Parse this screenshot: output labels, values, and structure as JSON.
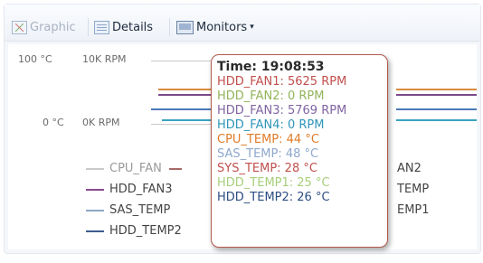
{
  "toolbar": {
    "graphic_label": "Graphic",
    "details_label": "Details",
    "monitors_label": "Monitors",
    "monitors_caret": "▾"
  },
  "chart": {
    "y_left_max": "100 °C",
    "y_left_min": "0 °C",
    "y_right_max": "10K RPM",
    "y_right_min": "0K RPM"
  },
  "legend": [
    {
      "label": "CPU_FAN",
      "color": "#c9c9c9"
    },
    {
      "label": "HDD_FAN3",
      "color": "#8b4a8e"
    },
    {
      "label": "SAS_TEMP",
      "color": "#8fa7c6"
    },
    {
      "label": "HDD_TEMP2",
      "color": "#3d5c8f"
    },
    {
      "label": "AN2",
      "color": "#a86b68"
    },
    {
      "label": "TEMP",
      "color": "#cf8d47"
    },
    {
      "label": "EMP1",
      "color": "#8fc06a"
    }
  ],
  "tooltip": {
    "time": "Time: 19:08:53",
    "rows": [
      {
        "text": "HDD_FAN1: 5625 RPM",
        "color": "#c0504d"
      },
      {
        "text": "HDD_FAN2: 0 RPM",
        "color": "#92b45a"
      },
      {
        "text": "HDD_FAN3: 5769 RPM",
        "color": "#8064a2"
      },
      {
        "text": "HDD_FAN4: 0 RPM",
        "color": "#2f95b8"
      },
      {
        "text": "CPU_TEMP: 44 °C",
        "color": "#e07b28"
      },
      {
        "text": "SAS_TEMP: 48 °C",
        "color": "#8ea8cc"
      },
      {
        "text": "SYS_TEMP: 28 °C",
        "color": "#c0504d"
      },
      {
        "text": "HDD_TEMP1: 25 °C",
        "color": "#a6cf7a"
      },
      {
        "text": "HDD_TEMP2: 26 °C",
        "color": "#2c4d82"
      }
    ]
  },
  "colors": {
    "series_orange": "#d98b3f",
    "series_purple": "#7a4a88",
    "series_blue": "#4a78b8",
    "series_teal": "#3aa3c0",
    "series_light": "#b8c8de"
  }
}
